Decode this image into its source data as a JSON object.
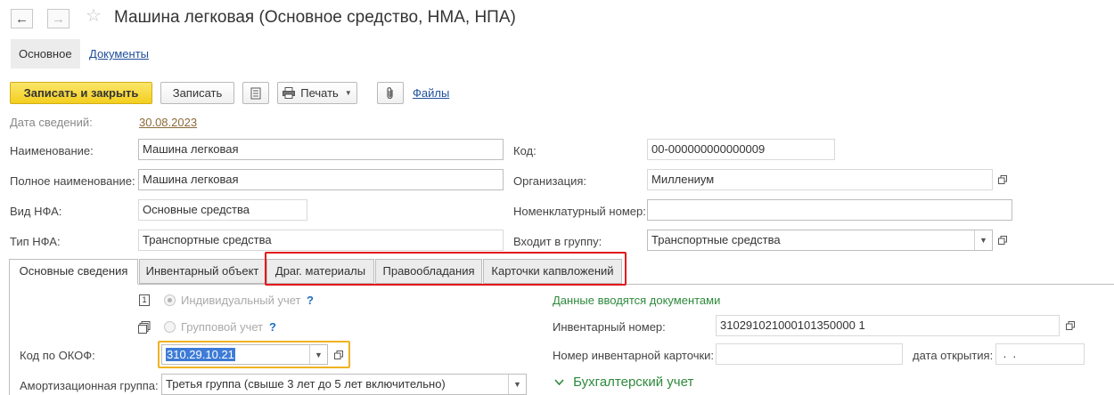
{
  "window": {
    "title": "Машина легковая (Основное средство, НМА, НПА)"
  },
  "page_tabs": [
    {
      "label": "Основное"
    },
    {
      "label": "Документы"
    }
  ],
  "toolbar": {
    "save_close_label": "Записать и закрыть",
    "save_label": "Записать",
    "print_label": "Печать",
    "files_label": "Файлы"
  },
  "form": {
    "date_label": "Дата сведений:",
    "date_value": "30.08.2023",
    "name_label": "Наименование:",
    "name_value": "Машина легковая",
    "fullname_label": "Полное наименование:",
    "fullname_value": "Машина легковая",
    "nfa_kind_label": "Вид НФА:",
    "nfa_kind_value": "Основные средства",
    "nfa_type_label": "Тип НФА:",
    "nfa_type_value": "Транспортные средства",
    "code_label": "Код:",
    "code_value": "00-000000000000009",
    "org_label": "Организация:",
    "org_value": "Миллениум",
    "nomenclature_label": "Номенклатурный номер:",
    "nomenclature_value": "",
    "group_label": "Входит в группу:",
    "group_value": "Транспортные средства"
  },
  "tabs": [
    {
      "label": "Основные сведения"
    },
    {
      "label": "Инвентарный объект"
    },
    {
      "label": "Драг. материалы"
    },
    {
      "label": "Правообладания"
    },
    {
      "label": "Карточки капвложений"
    }
  ],
  "main": {
    "individual_label": "Индивидуальный учет",
    "group_label": "Групповой учет",
    "help_mark": "?",
    "icon1_text": "1",
    "okof_label": "Код по ОКОФ:",
    "okof_value": "310.29.10.21",
    "amort_label": "Амортизационная группа:",
    "amort_value": "Третья группа (свыше 3 лет до 5 лет включительно)",
    "docs_note": "Данные вводятся документами",
    "inv_number_label": "Инвентарный номер:",
    "inv_number_value": "310291021000101350000 1",
    "inv_card_label": "Номер инвентарной карточки:",
    "inv_card_value": "",
    "open_date_label": "дата открытия:",
    "open_date_value": " .  .",
    "accounting_label": "Бухгалтерский учет"
  },
  "colors": {
    "accent_yellow": "#f3cf1f",
    "link_blue": "#1f4e9a",
    "highlight_red": "#e2171b",
    "focus_orange": "#f0b323",
    "selection_blue": "#3d7bd6",
    "note_green": "#2e8a3c"
  }
}
